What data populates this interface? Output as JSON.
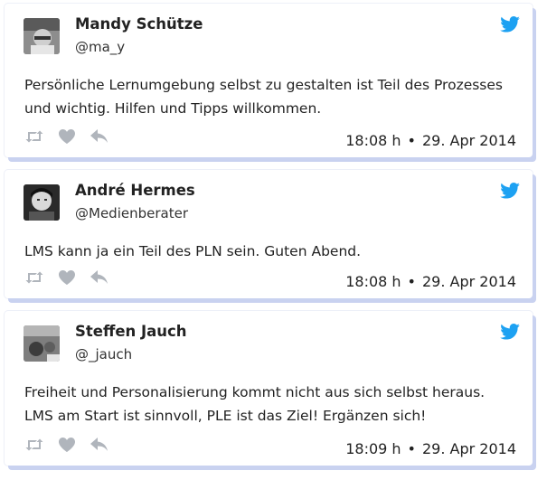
{
  "tweets": [
    {
      "name": "Mandy Schütze",
      "handle": "@ma_y",
      "text": "Persönliche Lernumgebung selbst zu gestalten ist Teil des Prozesses und wichtig. Hilfen und Tipps willkommen.",
      "time": "18:08 h",
      "date": "29. Apr 2014"
    },
    {
      "name": "André Hermes",
      "handle": "@Medienberater",
      "text": "LMS kann ja ein Teil des PLN sein. Guten Abend.",
      "time": "18:08 h",
      "date": "29. Apr 2014"
    },
    {
      "name": "Steffen Jauch",
      "handle": "@_jauch",
      "text": "Freiheit und Personalisierung kommt nicht aus sich selbst heraus. LMS am Start ist sinnvoll, PLE ist das Ziel! Ergänzen sich!",
      "time": "18:09 h",
      "date": "29. Apr 2014"
    }
  ],
  "separator": "•",
  "icons": {
    "brand": "twitter-bird-icon",
    "retweet": "retweet-icon",
    "favorite": "heart-icon",
    "reply": "reply-icon"
  },
  "colors": {
    "twitter_blue": "#1da1f2",
    "action_gray": "#b0b5bc",
    "card_shadow": "#c9d2f0"
  }
}
